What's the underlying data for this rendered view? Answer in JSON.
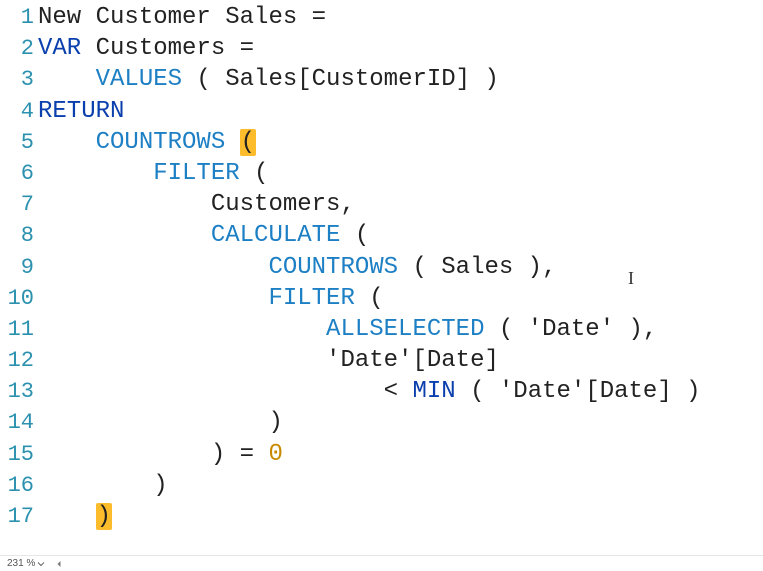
{
  "editor": {
    "lines": [
      {
        "n": "1",
        "tokens": [
          [
            "plain",
            "New Customer Sales = "
          ]
        ]
      },
      {
        "n": "2",
        "tokens": [
          [
            "kw",
            "VAR"
          ],
          [
            "plain",
            " Customers ="
          ]
        ]
      },
      {
        "n": "3",
        "tokens": [
          [
            "plain",
            "    "
          ],
          [
            "fn",
            "VALUES"
          ],
          [
            "plain",
            " ( Sales[CustomerID] )"
          ]
        ]
      },
      {
        "n": "4",
        "tokens": [
          [
            "kw",
            "RETURN"
          ]
        ]
      },
      {
        "n": "5",
        "tokens": [
          [
            "plain",
            "    "
          ],
          [
            "fn",
            "COUNTROWS"
          ],
          [
            "plain",
            " "
          ],
          [
            "match",
            "("
          ]
        ]
      },
      {
        "n": "6",
        "tokens": [
          [
            "plain",
            "        "
          ],
          [
            "fn",
            "FILTER"
          ],
          [
            "plain",
            " ("
          ]
        ]
      },
      {
        "n": "7",
        "tokens": [
          [
            "plain",
            "            Customers,"
          ]
        ]
      },
      {
        "n": "8",
        "tokens": [
          [
            "plain",
            "            "
          ],
          [
            "fn",
            "CALCULATE"
          ],
          [
            "plain",
            " ("
          ]
        ]
      },
      {
        "n": "9",
        "tokens": [
          [
            "plain",
            "                "
          ],
          [
            "fn",
            "COUNTROWS"
          ],
          [
            "plain",
            " ( Sales ),"
          ]
        ]
      },
      {
        "n": "10",
        "tokens": [
          [
            "plain",
            "                "
          ],
          [
            "fn",
            "FILTER"
          ],
          [
            "plain",
            " ("
          ]
        ]
      },
      {
        "n": "11",
        "tokens": [
          [
            "plain",
            "                    "
          ],
          [
            "fn",
            "ALLSELECTED"
          ],
          [
            "plain",
            " ( 'Date' ),"
          ]
        ]
      },
      {
        "n": "12",
        "tokens": [
          [
            "plain",
            "                    'Date'[Date]"
          ]
        ]
      },
      {
        "n": "13",
        "tokens": [
          [
            "plain",
            "                        < "
          ],
          [
            "kw",
            "MIN"
          ],
          [
            "plain",
            " ( 'Date'[Date] )"
          ]
        ]
      },
      {
        "n": "14",
        "tokens": [
          [
            "plain",
            "                )"
          ]
        ]
      },
      {
        "n": "15",
        "tokens": [
          [
            "plain",
            "            ) = "
          ],
          [
            "num",
            "0"
          ]
        ]
      },
      {
        "n": "16",
        "tokens": [
          [
            "plain",
            "        )"
          ]
        ]
      },
      {
        "n": "17",
        "tokens": [
          [
            "plain",
            "    "
          ],
          [
            "match",
            ")"
          ]
        ]
      }
    ]
  },
  "statusbar": {
    "zoom": "231 %"
  },
  "cursor": {
    "glyph": "I"
  }
}
